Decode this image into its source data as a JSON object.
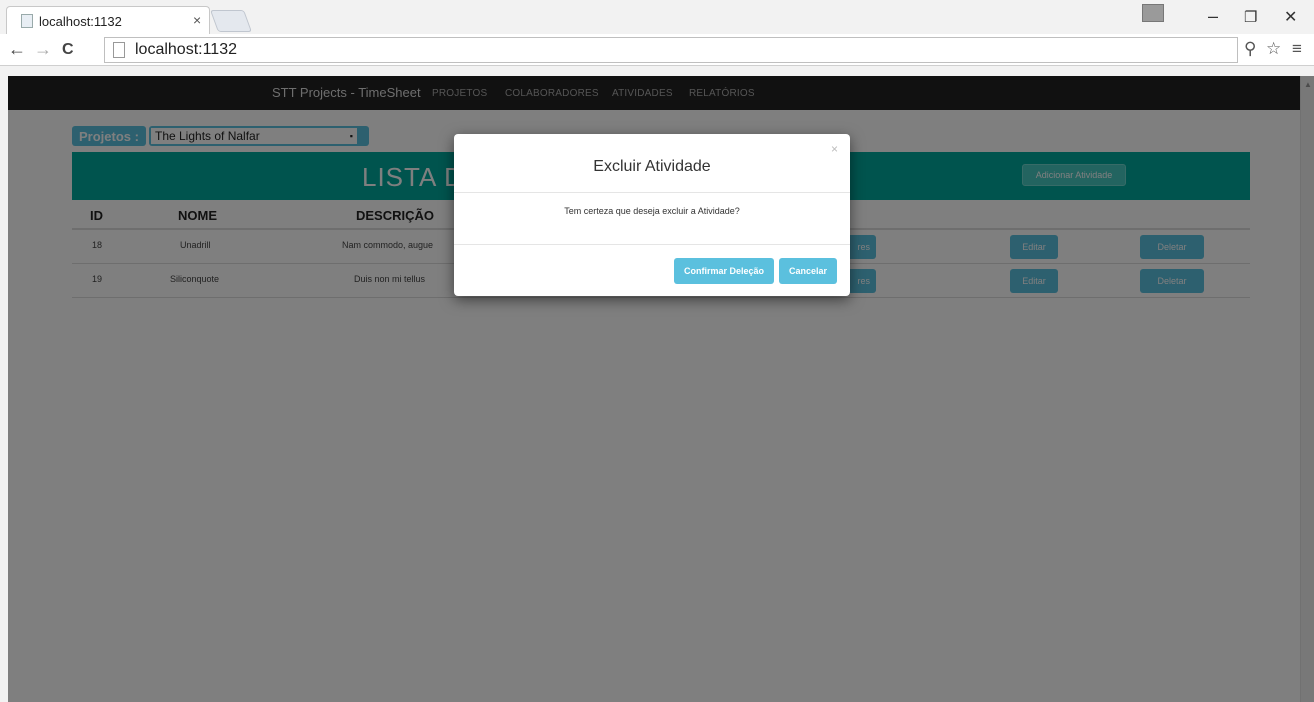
{
  "browser": {
    "tab_title": "localhost:1132",
    "tab_close": "×",
    "url": "localhost:1132",
    "controls": {
      "minimize": "–",
      "restore": "❐",
      "close": "✕"
    },
    "nav": {
      "back": "←",
      "forward": "→",
      "reload": "C"
    }
  },
  "navbar": {
    "brand": "STT Projects - TimeSheet",
    "links": [
      "PROJETOS",
      "COLABORADORES",
      "ATIVIDADES",
      "RELATÓRIOS"
    ]
  },
  "filter": {
    "label": "Projetos :",
    "selected": "The Lights of Nalfar"
  },
  "header": {
    "title": "LISTA D",
    "add_button": "Adicionar Atividade"
  },
  "table": {
    "columns": [
      "ID",
      "NOME",
      "DESCRIÇÃO"
    ],
    "rows": [
      {
        "id": "18",
        "nome": "Unadrill",
        "descricao": "Nam commodo, augue",
        "btn_partial": "res",
        "edit": "Editar",
        "delete": "Deletar"
      },
      {
        "id": "19",
        "nome": "Siliconquote",
        "descricao": "Duis non mi tellus",
        "btn_partial": "res",
        "edit": "Editar",
        "delete": "Deletar"
      }
    ]
  },
  "modal": {
    "title": "Excluir Atividade",
    "close": "×",
    "message": "Tem certeza que deseja excluir a Atividade?",
    "confirm": "Confirmar Deleção",
    "cancel": "Cancelar"
  },
  "colors": {
    "navbar": "#222222",
    "header": "#00a99d",
    "button_info": "#5bc0de",
    "overlay": "rgba(0,0,0,0.5)"
  }
}
